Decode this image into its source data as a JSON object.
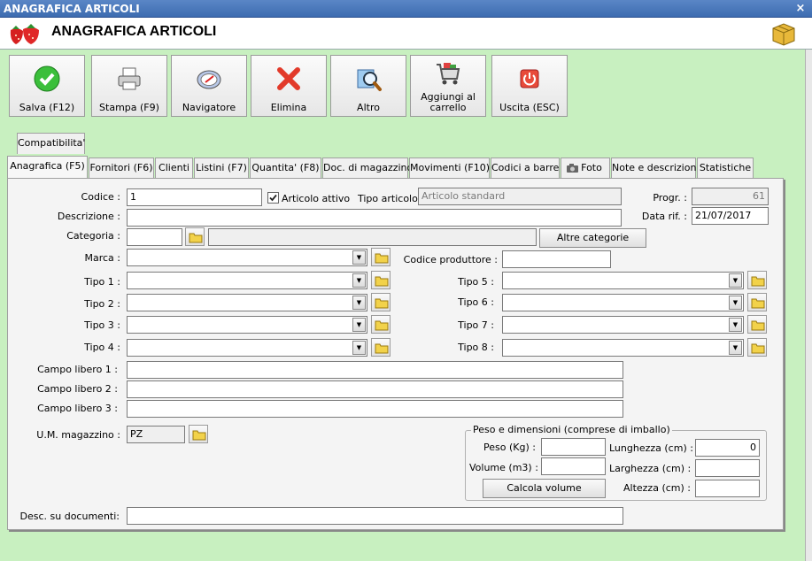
{
  "window": {
    "title": "ANAGRAFICA ARTICOLI",
    "close_glyph": "×"
  },
  "header": {
    "title": "ANAGRAFICA ARTICOLI",
    "logo_icon": "strawberry-icon",
    "corner_icon": "boxes-icon"
  },
  "toolbar": [
    {
      "label": "Salva (F12)",
      "icon": "check-icon"
    },
    {
      "label": "Stampa (F9)",
      "icon": "printer-icon"
    },
    {
      "label": "Navigatore",
      "icon": "compass-icon"
    },
    {
      "label": "Elimina",
      "icon": "delete-x-icon"
    },
    {
      "label": "Altro",
      "icon": "magnifier-icon"
    },
    {
      "label": "Aggiungi al carrello",
      "label_line1": "Aggiungi al",
      "label_line2": "carrello",
      "icon": "cart-icon"
    },
    {
      "label": "Uscita (ESC)",
      "icon": "power-icon"
    }
  ],
  "subtab": {
    "label": "Compatibilita'"
  },
  "tabs": [
    "Anagrafica (F5)",
    "Fornitori (F6)",
    "Clienti",
    "Listini (F7)",
    "Quantita' (F8)",
    "Doc. di magazzino",
    "Movimenti (F10)",
    "Codici a barre",
    "Foto",
    "Note e descrizioni",
    "Statistiche"
  ],
  "form": {
    "codice_label": "Codice :",
    "codice_value": "1",
    "articolo_attivo_label": "Articolo attivo",
    "articolo_attivo_checked": true,
    "tipo_articolo_label": "Tipo articolo :",
    "tipo_articolo_value": "Articolo standard",
    "progr_label": "Progr. :",
    "progr_value": "61",
    "descrizione_label": "Descrizione :",
    "data_rif_label": "Data rif. :",
    "data_rif_value": "21/07/2017",
    "categoria_label": "Categoria :",
    "altre_categorie_label": "Altre categorie",
    "marca_label": "Marca :",
    "codice_produttore_label": "Codice produttore :",
    "tipo_left": [
      "Tipo 1 :",
      "Tipo 2 :",
      "Tipo 3 :",
      "Tipo 4 :"
    ],
    "tipo_right": [
      "Tipo 5 :",
      "Tipo 6 :",
      "Tipo 7 :",
      "Tipo 8 :"
    ],
    "campo_libero": [
      "Campo libero 1 :",
      "Campo libero 2 :",
      "Campo libero 3 :"
    ],
    "um_label": "U.M. magazzino :",
    "um_value": "PZ",
    "desc_documenti_label": "Desc. su documenti:"
  },
  "dimensions": {
    "title": "Peso e dimensioni (comprese di imballo)",
    "peso_label": "Peso (Kg) :",
    "volume_label": "Volume (m3) :",
    "calcola_label": "Calcola volume",
    "lunghezza_label": "Lunghezza (cm) :",
    "lunghezza_value": "0",
    "larghezza_label": "Larghezza (cm) :",
    "altezza_label": "Altezza (cm) :"
  },
  "colors": {
    "background": "#c8f0c0",
    "titlebar": "#3d6cb0",
    "panel": "#f4f4f4"
  }
}
